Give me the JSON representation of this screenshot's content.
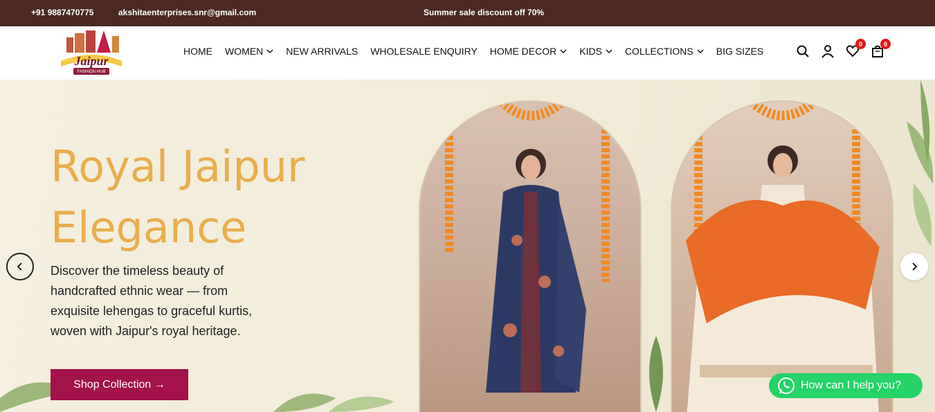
{
  "topbar": {
    "phone": "+91 9887470775",
    "email": "akshitaenterprises.snr@gmail.com",
    "promo": "Summer sale discount off 70%"
  },
  "logo": {
    "name": "Jaipur",
    "tagline": "FASHION HUB"
  },
  "nav": {
    "items": [
      {
        "label": "HOME",
        "dropdown": false
      },
      {
        "label": "WOMEN",
        "dropdown": true
      },
      {
        "label": "NEW ARRIVALS",
        "dropdown": false
      },
      {
        "label": "WHOLESALE ENQUIRY",
        "dropdown": false
      },
      {
        "label": "HOME DECOR",
        "dropdown": true
      },
      {
        "label": "KIDS",
        "dropdown": true
      },
      {
        "label": "COLLECTIONS",
        "dropdown": true
      },
      {
        "label": "BIG SIZES",
        "dropdown": false
      }
    ]
  },
  "header_icons": {
    "search": "search-icon",
    "account": "user-icon",
    "wishlist": "heart-icon",
    "wishlist_count": "0",
    "cart": "bag-icon",
    "cart_count": "0"
  },
  "hero": {
    "title_line1": "Royal Jaipur",
    "title_line2": "Elegance",
    "description": "Discover the timeless beauty of handcrafted ethnic wear — from exquisite lehengas to graceful kurtis, woven with Jaipur's royal heritage.",
    "button_label": "Shop Collection →"
  },
  "whatsapp": {
    "label": "How can I help you?"
  },
  "colors": {
    "topbar_bg": "#4a2a22",
    "title": "#e9ae4c",
    "button": "#a3124a",
    "badge": "#e01818",
    "whatsapp": "#25d366"
  }
}
